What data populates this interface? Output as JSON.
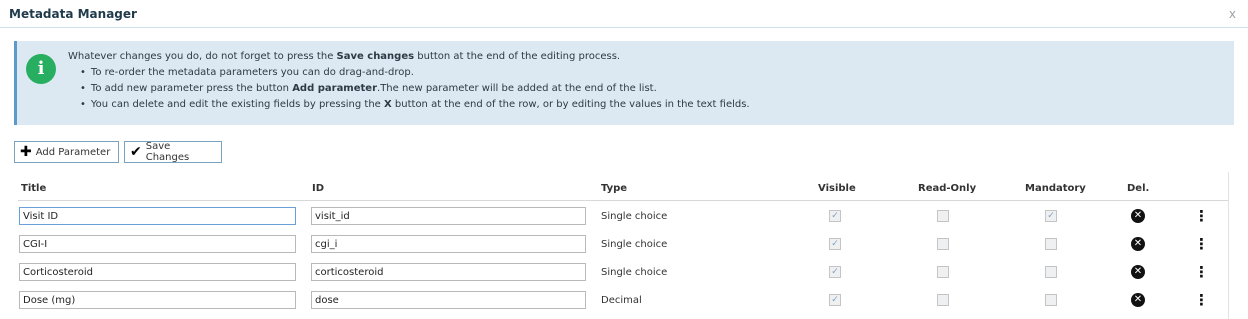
{
  "dialog": {
    "title": "Metadata Manager",
    "close_glyph": "x"
  },
  "info": {
    "icon_glyph": "i",
    "lead_pre": "Whatever changes you do, do not forget to press the ",
    "lead_bold": "Save changes",
    "lead_post": " button at the end of the editing process.",
    "bullet1": "To re-order the metadata parameters you can do drag-and-drop.",
    "bullet2_pre": "To add new parameter press the button ",
    "bullet2_bold": "Add parameter",
    "bullet2_post": ".The new parameter will be added at the end of the list.",
    "bullet3_pre": "You can delete and edit the existing fields by pressing the ",
    "bullet3_bold": "X",
    "bullet3_post": " button at the end of the row, or by editing the values in the text fields."
  },
  "toolbar": {
    "add_label": "Add Parameter",
    "save_label": "Save Changes"
  },
  "table": {
    "headers": {
      "title": "Title",
      "id": "ID",
      "type": "Type",
      "visible": "Visible",
      "readonly": "Read-Only",
      "mandatory": "Mandatory",
      "del": "Del."
    },
    "rows": [
      {
        "title": "Visit ID",
        "id": "visit_id",
        "type": "Single choice",
        "visible": true,
        "readonly": false,
        "mandatory": true
      },
      {
        "title": "CGI-I",
        "id": "cgi_i",
        "type": "Single choice",
        "visible": true,
        "readonly": false,
        "mandatory": false
      },
      {
        "title": "Corticosteroid",
        "id": "corticosteroid",
        "type": "Single choice",
        "visible": true,
        "readonly": false,
        "mandatory": false
      },
      {
        "title": "Dose (mg)",
        "id": "dose",
        "type": "Decimal",
        "visible": true,
        "readonly": false,
        "mandatory": false
      }
    ]
  },
  "icons": {
    "add": "plus-icon",
    "save": "checkmark-icon",
    "delete": "x-circle-icon",
    "more": "vertical-ellipsis-icon"
  },
  "colors": {
    "info_bg": "#dce9f3",
    "info_icon": "#27ae60",
    "accent_border": "#5c9ac9"
  }
}
